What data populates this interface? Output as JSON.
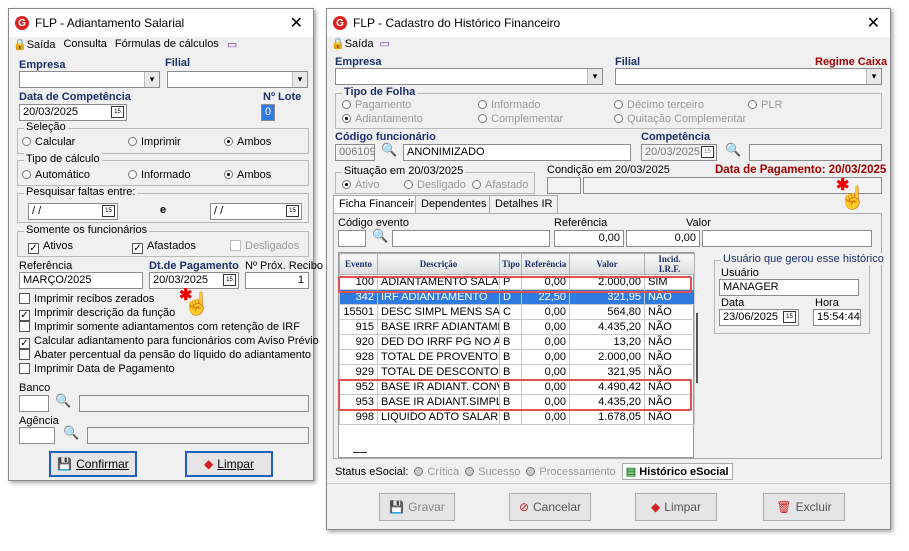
{
  "left": {
    "title": "FLP - Adiantamento Salarial",
    "menu": {
      "exit": "Saída",
      "query": "Consulta",
      "formulas": "Fórmulas de cálculos"
    },
    "empresa_label": "Empresa",
    "filial_label": "Filial",
    "dt_competencia_label": "Data de Competência",
    "dt_competencia_value": "20/03/2025",
    "lote_label": "Nº Lote",
    "lote_value": "0",
    "selecao": {
      "title": "Seleção",
      "options": [
        "Calcular",
        "Imprimir",
        "Ambos"
      ],
      "selected": "Ambos"
    },
    "tipo_calculo": {
      "title": "Tipo de cálculo",
      "options": [
        "Automático",
        "Informado",
        "Ambos"
      ],
      "selected": "Ambos"
    },
    "faltas": {
      "title": "Pesquisar faltas entre:",
      "from": "/ /",
      "sep": "e",
      "to": "/ /"
    },
    "somente": {
      "title": "Somente os funcionários",
      "ativos": "Ativos",
      "afastados": "Afastados",
      "desligados": "Desligados"
    },
    "referencia_label": "Referência",
    "referencia_value": "MARÇO/2025",
    "dt_pagamento_label": "Dt.de Pagamento",
    "dt_pagamento_value": "20/03/2025",
    "prox_recibo_label": "Nº Próx. Recibo",
    "prox_recibo_value": "1",
    "options": [
      {
        "label": "Imprimir recibos zerados",
        "checked": false
      },
      {
        "label": "Imprimir descrição da função",
        "checked": true
      },
      {
        "label": "Imprimir somente adiantamentos com retenção de IRF",
        "checked": false
      },
      {
        "label": "Calcular adiantamento para funcionários com Aviso Prévio",
        "checked": true
      },
      {
        "label": "Abater percentual da pensão do líquido do adiantamento",
        "checked": false
      },
      {
        "label": "Imprimir Data de Pagamento",
        "checked": false
      }
    ],
    "banco_label": "Banco",
    "agencia_label": "Agência",
    "confirm": "Confirmar",
    "clear": "Limpar"
  },
  "right": {
    "title": "FLP - Cadastro do Histórico Financeiro",
    "menu": {
      "exit": "Saída"
    },
    "empresa_label": "Empresa",
    "filial_label": "Filial",
    "regime_label": "Regime Caixa",
    "tipo_folha": {
      "title": "Tipo de Folha",
      "options": [
        "Pagamento",
        "Informado",
        "Décimo terceiro",
        "PLR",
        "Adiantamento",
        "Complementar",
        "Quitação Complementar"
      ],
      "selected": "Adiantamento"
    },
    "cod_func_label": "Código funcionário",
    "cod_func_value": "006109",
    "func_name": "ANONIMIZADO",
    "competencia_label": "Competência",
    "competencia_value": "20/03/2025",
    "situacao": {
      "title": "Situação em 20/03/2025",
      "options": [
        "Ativo",
        "Desligado",
        "Afastado"
      ]
    },
    "condicao_label": "Condição em 20/03/2025",
    "dt_pagamento": "Data de Pagamento: 20/03/2025",
    "tabs": [
      "Ficha Financeira",
      "Dependentes",
      "Detalhes IR"
    ],
    "cod_evento_label": "Código evento",
    "referencia_label": "Referência",
    "valor_label": "Valor",
    "referencia_value": "0,00",
    "valor_value": "0,00",
    "grid": {
      "headers": [
        "Evento",
        "Descrição",
        "Tipo",
        "Referência",
        "Valor",
        "Incid. I.R.F."
      ],
      "rows": [
        [
          "100",
          "ADIANTAMENTO SALAR...",
          "P",
          "0,00",
          "2.000,00",
          "SIM"
        ],
        [
          "342",
          "IRF ADIANTAMENTO",
          "D",
          "22,50",
          "321,95",
          "NÃO"
        ],
        [
          "15501",
          "DESC SIMPL MENS SAL...",
          "C",
          "0,00",
          "564,80",
          "NÃO"
        ],
        [
          "915",
          "BASE IRRF ADIANTAME...",
          "B",
          "0,00",
          "4.435,20",
          "NÃO"
        ],
        [
          "920",
          "DED DO IRRF PG NO AD...",
          "B",
          "0,00",
          "13,20",
          "NÃO"
        ],
        [
          "928",
          "TOTAL DE PROVENTOS",
          "B",
          "0,00",
          "2.000,00",
          "NÃO"
        ],
        [
          "929",
          "TOTAL DE DESCONTOS",
          "B",
          "0,00",
          "321,95",
          "NÃO"
        ],
        [
          "952",
          "BASE IR ADIANT. CONV...",
          "B",
          "0,00",
          "4.490,42",
          "NÃO"
        ],
        [
          "953",
          "BASE IR ADIANT.SIMPLIF",
          "B",
          "0,00",
          "4.435,20",
          "NÃO"
        ],
        [
          "998",
          "LIQUIDO ADTO SALARIO",
          "B",
          "0,00",
          "1.678,05",
          "NÃO"
        ]
      ],
      "selected_row": 1
    },
    "usuario_group": "Usuário que gerou esse histórico",
    "usuario_label": "Usuário",
    "usuario_value": "MANAGER",
    "data_label": "Data",
    "data_value": "23/06/2025",
    "hora_label": "Hora",
    "hora_value": "15:54:44",
    "status_label": "Status eSocial:",
    "status_options": [
      "Crítica",
      "Sucesso",
      "Processamento"
    ],
    "historico_esocial": "Histórico eSocial",
    "buttons": {
      "save": "Gravar",
      "cancel": "Cancelar",
      "clear": "Limpar",
      "delete": "Excluir"
    }
  }
}
